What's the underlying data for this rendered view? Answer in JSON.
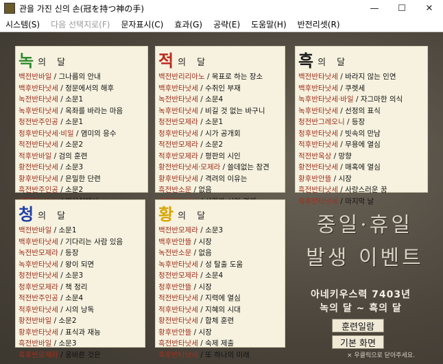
{
  "window": {
    "title": "관을 가진 신의 손(冠を持つ神の手)",
    "min_label": "—",
    "max_label": "☐",
    "close_label": "✕"
  },
  "menu": [
    {
      "label": "시스템(S)",
      "enabled": true
    },
    {
      "label": "다음 선택지로(F)",
      "enabled": false
    },
    {
      "label": "문자표시(C)",
      "enabled": true
    },
    {
      "label": "효과(G)",
      "enabled": true
    },
    {
      "label": "공략(E)",
      "enabled": true
    },
    {
      "label": "도움말(H)",
      "enabled": true
    },
    {
      "label": "반전리셋(R)",
      "enabled": true
    }
  ],
  "colors": {
    "green": "#2e8b2e",
    "red": "#c0281c",
    "black": "#1a1a1a",
    "blue": "#1f3fa8",
    "yellow": "#d8a400"
  },
  "panels": [
    {
      "id": "green",
      "glyph": "녹",
      "suffix": "의 달",
      "entries": [
        {
          "k": "백전반바일",
          "v": " / 그나름의 안내"
        },
        {
          "k": "백후반타낫세",
          "v": " / 정문에서의 해후"
        },
        {
          "k": "녹전반타낫세",
          "v": " / 소문1"
        },
        {
          "k": "녹후반타낫세",
          "v": " / 옥좌를 바라는 마음"
        },
        {
          "k": "청전반주인공",
          "v": " / 소문1"
        },
        {
          "k": "청후반타낫세·비일",
          "v": " / 염미의 응수"
        },
        {
          "k": "적전반타낫세",
          "v": " / 소문2"
        },
        {
          "k": "적후반바일",
          "v": " / 검의 훈련"
        },
        {
          "k": "황전반타낫세",
          "v": " / 소문3"
        },
        {
          "k": "황후반타낫세",
          "v": " / 은밀한 단련"
        },
        {
          "k": "흑전반주인공",
          "v": " / 소문2"
        },
        {
          "k": "흑후반타낫세",
          "v": " / 의상실에서"
        }
      ]
    },
    {
      "id": "red",
      "glyph": "적",
      "suffix": "의 달",
      "entries": [
        {
          "k": "백전반리리아노",
          "v": " / 목표로 하는 장소"
        },
        {
          "k": "백후반타낫세",
          "v": " / 수취인 부재"
        },
        {
          "k": "녹전반타낫세",
          "v": " / 소문4"
        },
        {
          "k": "녹후반타낫세",
          "v": " / 비길 것 없는 바구니"
        },
        {
          "k": "청전반모제라",
          "v": " / 소문1"
        },
        {
          "k": "청후반타낫세",
          "v": " / 시가 공개회"
        },
        {
          "k": "적전반모제라",
          "v": " / 소문2"
        },
        {
          "k": "적후반모제라",
          "v": " / 평판의 시인"
        },
        {
          "k": "황전반타낫세·모제라",
          "v": " / 쓸데없는 참견"
        },
        {
          "k": "황후반타낫세",
          "v": " / 격려의 이유는"
        },
        {
          "k": "흑전반소문",
          "v": " / 없음"
        },
        {
          "k": "흑후반타낫세",
          "v": " / 사람과 신의 경계"
        }
      ]
    },
    {
      "id": "black",
      "glyph": "흑",
      "suffix": "의 달",
      "entries": [
        {
          "k": "백전반타낫세",
          "v": " / 바라지 않는 인연"
        },
        {
          "k": "백후반타낫세",
          "v": " / 쿠렛세"
        },
        {
          "k": "녹후반타낫세·바일",
          "v": " / 자그마한 의식"
        },
        {
          "k": "녹후반타낫세",
          "v": " / 선정의 표식"
        },
        {
          "k": "청전반그레오니",
          "v": " / 등장"
        },
        {
          "k": "청후반타낫세",
          "v": " / 빗속의 만남"
        },
        {
          "k": "적후반타낫세",
          "v": " / 무용에 열심"
        },
        {
          "k": "적전반옥상",
          "v": " / 망향"
        },
        {
          "k": "황전반타낫세",
          "v": " / 매혹에 열심"
        },
        {
          "k": "황후반안뜰",
          "v": " / 시장"
        },
        {
          "k": "흑전반타낫세",
          "v": " / 사랑스러운 꿈"
        },
        {
          "k": "흑후반타낫세",
          "v": " / 마지막 날"
        }
      ]
    },
    {
      "id": "blue",
      "glyph": "청",
      "suffix": "의 달",
      "entries": [
        {
          "k": "백전반바일",
          "v": " / 소문1"
        },
        {
          "k": "백후반타낫세",
          "v": " / 기다리는 사람 있음"
        },
        {
          "k": "녹전반모제라",
          "v": " / 등장"
        },
        {
          "k": "녹후반타낫세",
          "v": " / 왕이 되면"
        },
        {
          "k": "청전반타낫세",
          "v": " / 소문3"
        },
        {
          "k": "청후반모제라",
          "v": " / 책 정리"
        },
        {
          "k": "적전반주인공",
          "v": " / 소문4"
        },
        {
          "k": "적후반타낫세",
          "v": " / 시의 낭독"
        },
        {
          "k": "황전반바일",
          "v": " / 소문2"
        },
        {
          "k": "황후반타낫세",
          "v": " / 표식과 재능"
        },
        {
          "k": "흑전반바일",
          "v": " / 소문3"
        },
        {
          "k": "흑후반모제라",
          "v": " / 옹바른 것은"
        }
      ]
    },
    {
      "id": "yellow",
      "glyph": "황",
      "suffix": "의 달",
      "entries": [
        {
          "k": "백전반모제라",
          "v": " / 소문3"
        },
        {
          "k": "백후반안뜰",
          "v": " / 시장"
        },
        {
          "k": "녹전반소문",
          "v": " / 없음"
        },
        {
          "k": "녹후반타낫세",
          "v": " / 성 탈출 도움"
        },
        {
          "k": "청전반모제라",
          "v": " / 소문4"
        },
        {
          "k": "청후반안뜰",
          "v": " / 시장"
        },
        {
          "k": "적전반타낫세",
          "v": " / 지력에 열심"
        },
        {
          "k": "적후반타낫세",
          "v": " / 지혜의 시대"
        },
        {
          "k": "황전반타낫세",
          "v": " / 합체 훈련"
        },
        {
          "k": "황후반안뜰",
          "v": " / 시장"
        },
        {
          "k": "흑전반타낫세",
          "v": " / 숙제 제출"
        },
        {
          "k": "흑후반타낫세",
          "v": " / 또 하나의 미래"
        }
      ]
    }
  ],
  "event_title_line1": "중일·휴일",
  "event_title_line2": "발생 이벤트",
  "info_line1": "아네키우스력 7403년",
  "info_line2": "녹의 달 ~ 흑의 달",
  "buttons": {
    "training": "훈련일람",
    "home": "기본 화면"
  },
  "hint": "× 우클릭으로 닫아주세요."
}
